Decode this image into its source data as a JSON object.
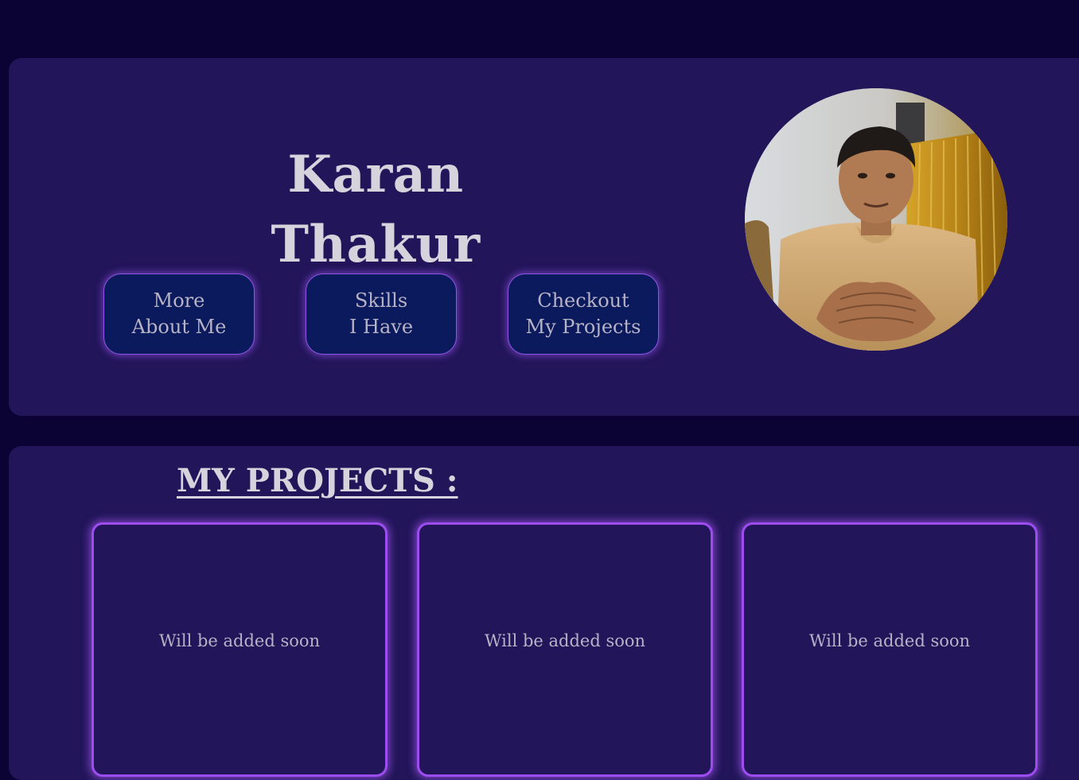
{
  "hero": {
    "name": "Karan Thakur",
    "buttons": [
      {
        "line1": "More",
        "line2": "About Me"
      },
      {
        "line1": "Skills",
        "line2": "I Have"
      },
      {
        "line1": "Checkout",
        "line2": "My Projects"
      }
    ]
  },
  "projects": {
    "title": "MY PROJECTS :",
    "cards": [
      {
        "text": "Will be added soon"
      },
      {
        "text": "Will be added soon"
      },
      {
        "text": "Will be added soon"
      }
    ]
  },
  "colors": {
    "page_background": "#0a0333",
    "panel_background": "#22155a",
    "button_background": "#0b1a5c",
    "accent_glow": "#9d4cf0",
    "heading_text": "#d6d3dc",
    "body_text": "#b7b3c6"
  }
}
